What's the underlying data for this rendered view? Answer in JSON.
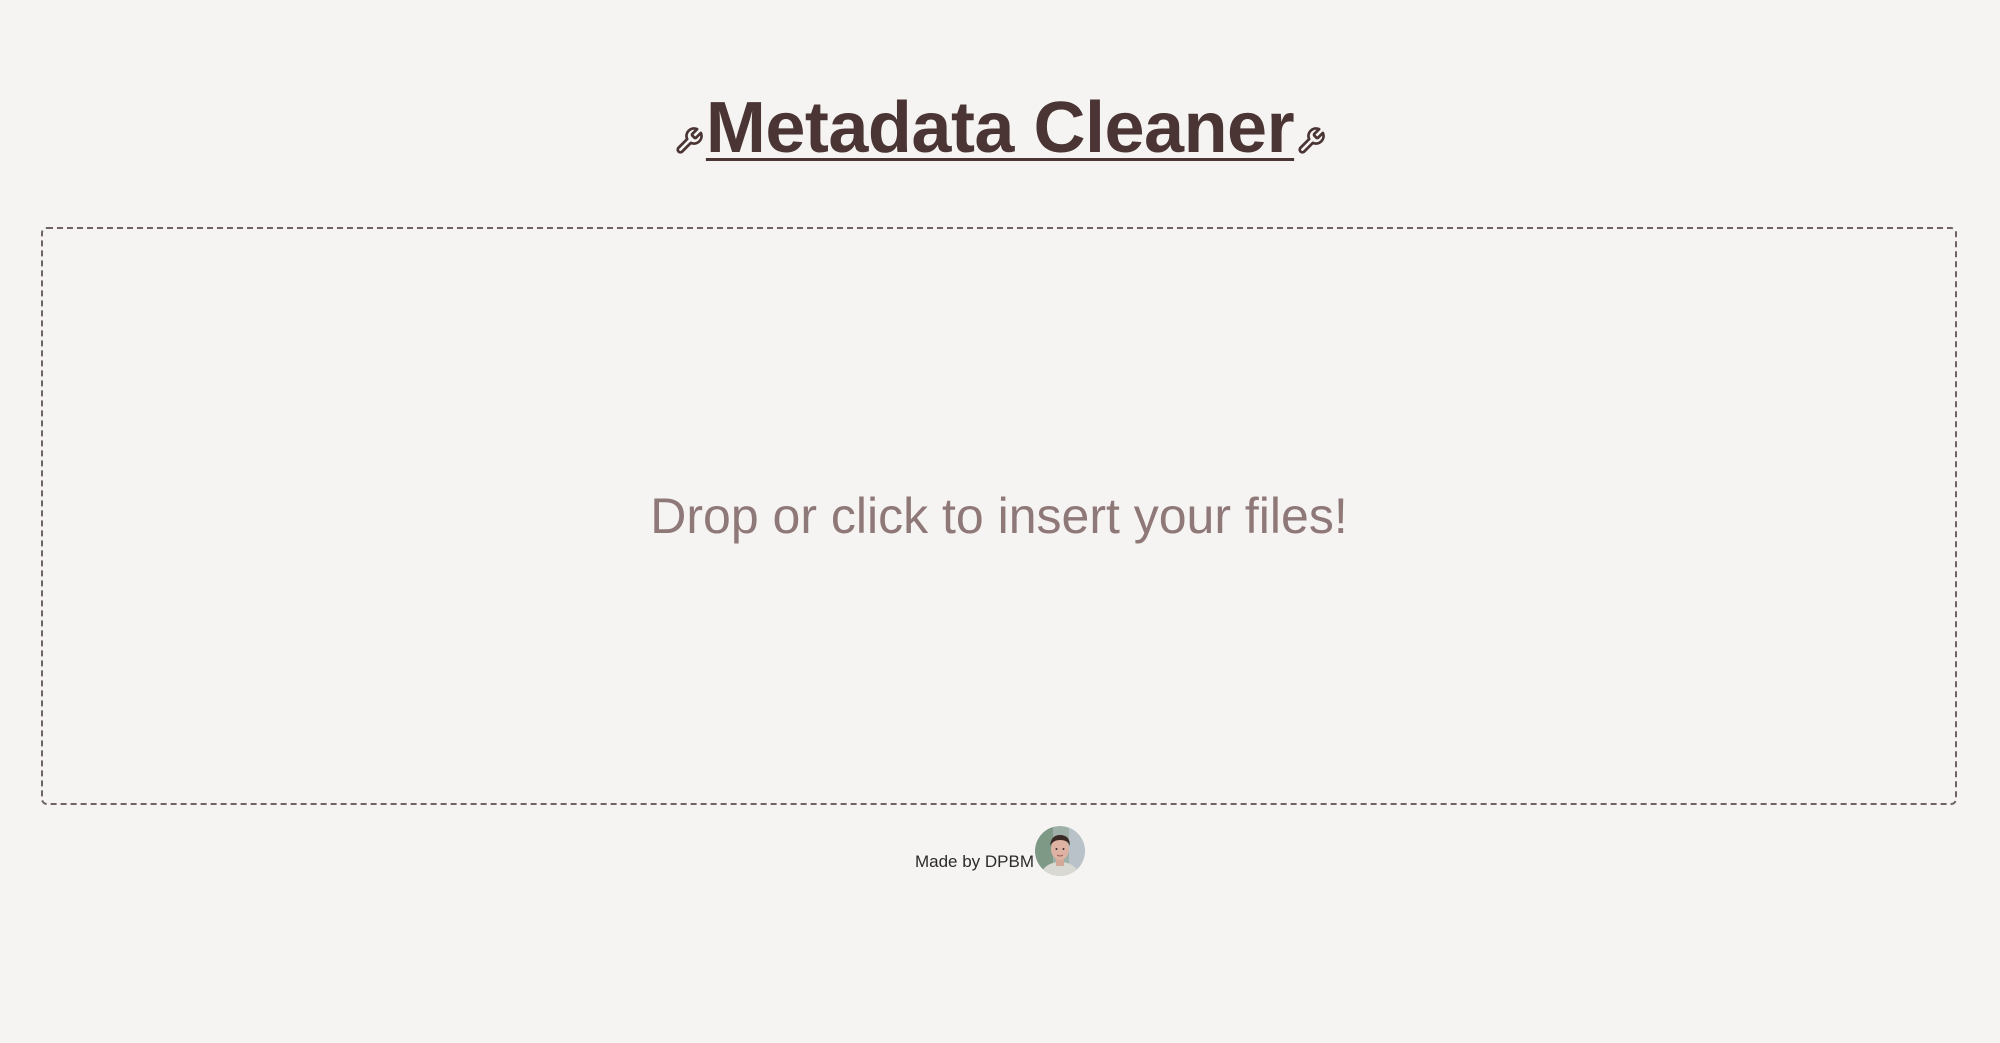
{
  "header": {
    "title": "Metadata Cleaner",
    "left_icon": "wrench-icon",
    "right_icon": "wrench-icon"
  },
  "dropzone": {
    "label": "Drop or click to insert your files!"
  },
  "footer": {
    "credit": "Made by DPBM",
    "avatar_icon": "avatar"
  },
  "colors": {
    "background": "#f5f4f2",
    "title": "#4a3434",
    "dropzone_text": "#8f7878",
    "dropzone_border": "#6e6464"
  }
}
